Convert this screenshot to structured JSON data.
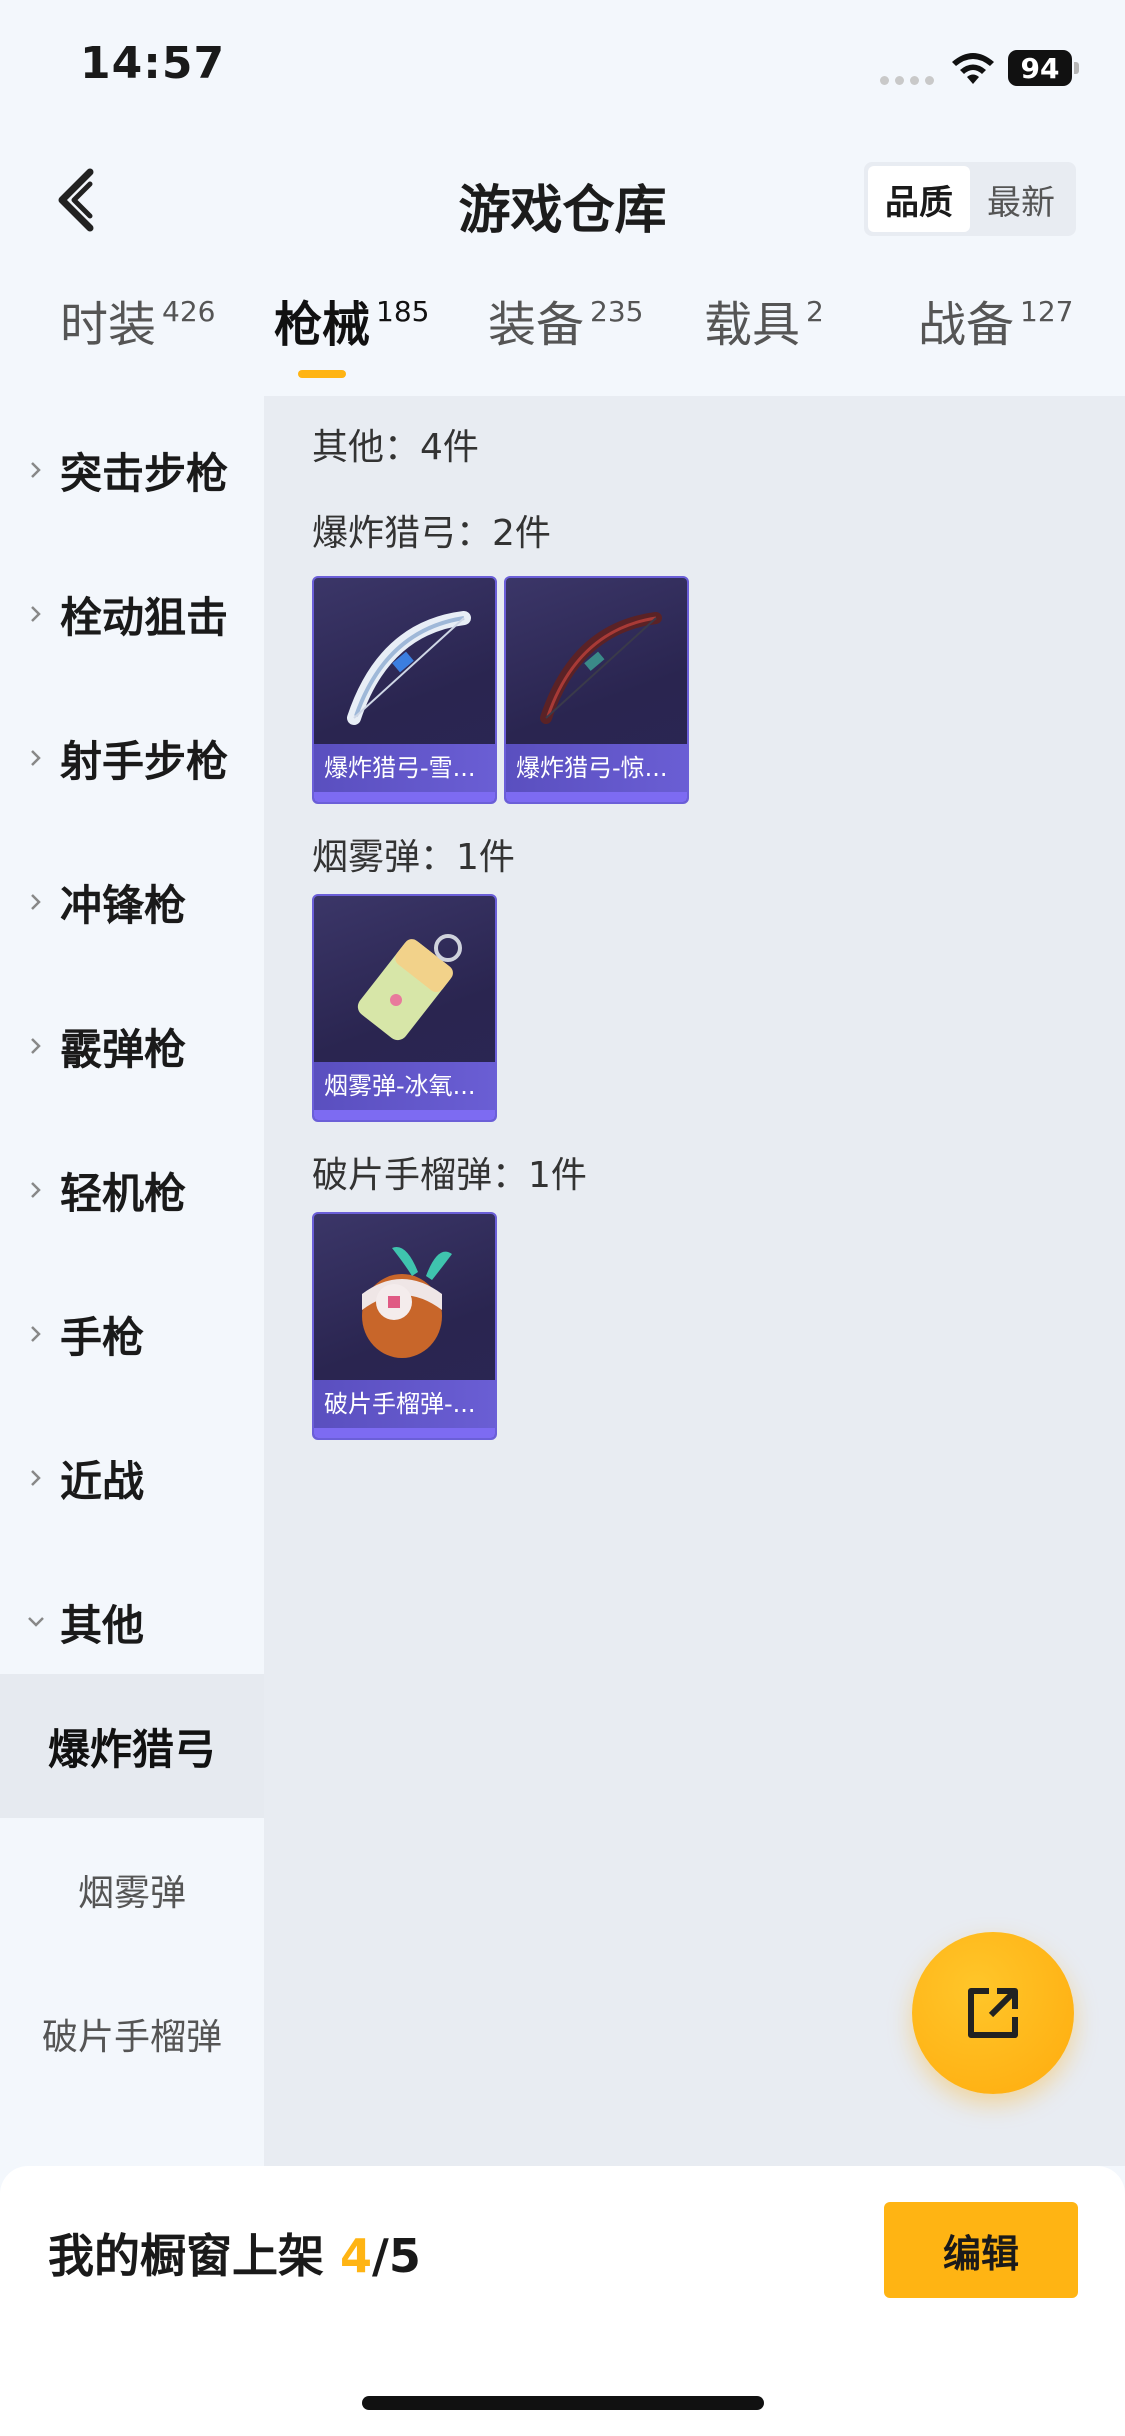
{
  "status": {
    "time": "14:57",
    "battery": "94"
  },
  "header": {
    "title": "游戏仓库",
    "sort_options": [
      "品质",
      "最新"
    ],
    "active_sort": "品质"
  },
  "tabs": [
    {
      "label": "时装",
      "count": "426"
    },
    {
      "label": "枪械",
      "count": "185",
      "active": true
    },
    {
      "label": "装备",
      "count": "235"
    },
    {
      "label": "载具",
      "count": "2"
    },
    {
      "label": "战备",
      "count": "127"
    }
  ],
  "sidebar": {
    "categories": [
      "突击步枪",
      "栓动狙击",
      "射手步枪",
      "冲锋枪",
      "霰弹枪",
      "轻机枪",
      "手枪",
      "近战",
      "其他"
    ],
    "expanded": "其他",
    "subcategories": [
      "爆炸猎弓",
      "烟雾弹",
      "破片手榴弹"
    ],
    "active_sub": "爆炸猎弓"
  },
  "content": {
    "summary": "其他：4件",
    "groups": [
      {
        "title": "爆炸猎弓：2件",
        "items": [
          "爆炸猎弓-雪...",
          "爆炸猎弓-惊..."
        ]
      },
      {
        "title": "烟雾弹：1件",
        "items": [
          "烟雾弹-冰氧..."
        ]
      },
      {
        "title": "破片手榴弹：1件",
        "items": [
          "破片手榴弹-..."
        ]
      }
    ]
  },
  "bottom_bar": {
    "label": "我的橱窗上架",
    "current": "4",
    "total": "/5",
    "edit_label": "编辑"
  },
  "colors": {
    "accent": "#ffb413",
    "card_bg": "#2a2550",
    "card_label": "#5a4fbf"
  }
}
